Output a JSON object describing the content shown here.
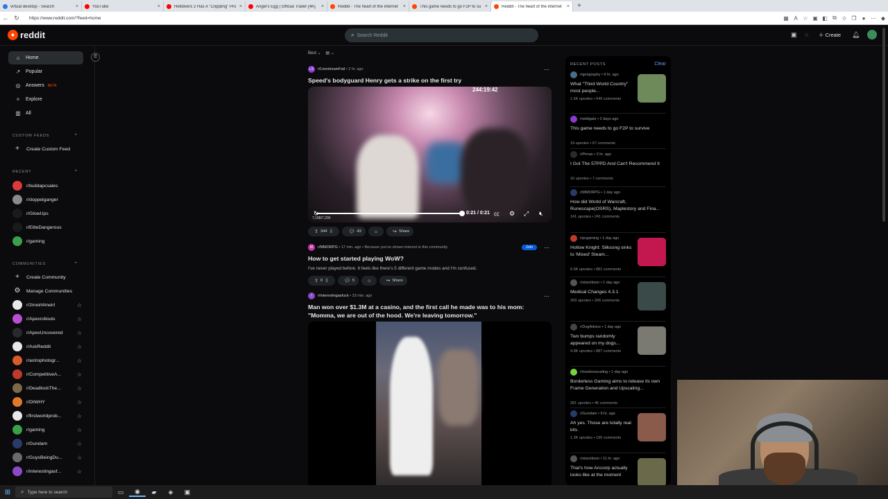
{
  "browser": {
    "tabs": [
      {
        "title": "virtual desktop - Search",
        "color": "#2a7ae2"
      },
      {
        "title": "YouTube",
        "color": "#ff0000"
      },
      {
        "title": "Helldivers 2 Has A \"Crippling\" Pro",
        "color": "#ff0000"
      },
      {
        "title": "Angel's Egg | Official Trailer [4K]",
        "color": "#ff0000"
      },
      {
        "title": "Reddit - The heart of the internet",
        "color": "#ff4500"
      },
      {
        "title": "This game needs to go F2P to su",
        "color": "#ff4500"
      },
      {
        "title": "Reddit - The heart of the internet",
        "color": "#ff4500"
      }
    ],
    "active_tab": 6,
    "url": "https://www.reddit.com/?feed=home"
  },
  "header": {
    "logo_text": "reddit",
    "search_placeholder": "Search Reddit",
    "create_label": "Create"
  },
  "leftnav": {
    "items": [
      {
        "label": "Home",
        "icon": "home-icon",
        "glyph": "⌂"
      },
      {
        "label": "Popular",
        "icon": "popular-icon",
        "glyph": "↗"
      },
      {
        "label": "Answers",
        "icon": "answers-icon",
        "glyph": "◎"
      },
      {
        "label": "Explore",
        "icon": "explore-icon",
        "glyph": "✧"
      },
      {
        "label": "All",
        "icon": "all-icon",
        "glyph": "▥"
      }
    ],
    "answers_badge": "BETA",
    "custom_feeds_header": "CUSTOM FEEDS",
    "create_custom_feed": "Create Custom Feed",
    "recent_header": "RECENT",
    "recent": [
      {
        "name": "r/buildapcsales",
        "color": "#d93a3a"
      },
      {
        "name": "r/doppelganger",
        "color": "#8a8a8a"
      },
      {
        "name": "r/GlowUps",
        "color": "#1a1a1a"
      },
      {
        "name": "r/EliteDangerous",
        "color": "#1a1a1a"
      },
      {
        "name": "r/gaming",
        "color": "#3aa14a"
      }
    ],
    "communities_header": "COMMUNITIES",
    "create_community": "Create Community",
    "manage_communities": "Manage Communities",
    "communities": [
      {
        "name": "r/2meirl4meirl",
        "color": "#e8e8e8"
      },
      {
        "name": "r/Apexrollouts",
        "color": "#b84fd1"
      },
      {
        "name": "r/ApexUncovered",
        "color": "#2a2a2a"
      },
      {
        "name": "r/AskReddit",
        "color": "#e8e8e8"
      },
      {
        "name": "r/astrophotogr...",
        "color": "#d95a2a"
      },
      {
        "name": "r/CompetitiveA...",
        "color": "#c0392b"
      },
      {
        "name": "r/DeadlockThe...",
        "color": "#7a6a4a"
      },
      {
        "name": "r/DIWHY",
        "color": "#e07a2a"
      },
      {
        "name": "r/firstworldprob...",
        "color": "#e8e8e8"
      },
      {
        "name": "r/gaming",
        "color": "#3aa14a"
      },
      {
        "name": "r/Gundam",
        "color": "#2a3a6a"
      },
      {
        "name": "r/GuysBeingDu...",
        "color": "#6a6a6a"
      },
      {
        "name": "r/interestingasf...",
        "color": "#8a4ac8"
      }
    ]
  },
  "feed": {
    "sort_label": "Best",
    "posts": [
      {
        "sub": "r/LivestreamFail",
        "time": "2 hr. ago",
        "title": "Speed's bodyguard Henry gets a strike on the first try",
        "upvotes": "344",
        "comments": "43",
        "share": "Share",
        "video_counter": "244:19:42",
        "video_time": "0:21 / 0:21",
        "video_small": "7,188/7,200"
      },
      {
        "sub": "r/MMORPG",
        "time": "17 min. ago",
        "reason": "Because you've shown interest in this community",
        "join": "Join",
        "title": "How to get started playing WoW?",
        "body": "I've never played before. It feels like there's 5 different game modes and I'm confused.",
        "upvotes": "0",
        "comments": "5",
        "share": "Share"
      },
      {
        "sub": "r/interestingasfuck",
        "time": "23 min. ago",
        "title": "Man won over $1.3M at a casino, and the first call he made was to his mom: \"Momma, we are out of the hood. We're leaving tomorrow.\""
      }
    ]
  },
  "recent_posts": {
    "header": "RECENT POSTS",
    "clear": "Clear",
    "items": [
      {
        "sub": "r/geography",
        "time": "6 hr. ago",
        "title": "What \"Third World Country\" most people...",
        "upvotes": "1.5K upvotes",
        "comments": "549 comments",
        "thumb": "#6f8a5a"
      },
      {
        "sub": "r/wildgate",
        "time": "2 days ago",
        "title": "This game needs to go F2P to survive",
        "upvotes": "19 upvotes",
        "comments": "67 comments",
        "thumb": ""
      },
      {
        "sub": "r/Pimax",
        "time": "3 hr. ago",
        "title": "I Got The 57PPD And Can't Recommend It",
        "upvotes": "16 upvotes",
        "comments": "7 comments",
        "thumb": ""
      },
      {
        "sub": "r/MMORPG",
        "time": "1 day ago",
        "title": "How did World of Warcraft, Runescape(OSRS), Maplestory and Fina...",
        "upvotes": "141 upvotes",
        "comments": "241 comments",
        "thumb": ""
      },
      {
        "sub": "r/pcgaming",
        "time": "1 day ago",
        "title": "Hollow Knight: Silksong sinks to 'Mixed' Steam...",
        "upvotes": "6.5K upvotes",
        "comments": "881 comments",
        "thumb": "#c2184f"
      },
      {
        "sub": "r/starcitizen",
        "time": "1 day ago",
        "title": "Medical Changes 4.3.1",
        "upvotes": "293 upvotes",
        "comments": "206 comments",
        "thumb": "#3a4a48"
      },
      {
        "sub": "r/DogAdvice",
        "time": "1 day ago",
        "title": "Two bumps randomly appeared on my dogs...",
        "upvotes": "4.9K upvotes",
        "comments": "887 comments",
        "thumb": "#7a7a72"
      },
      {
        "sub": "r/losslessscaling",
        "time": "1 day ago",
        "title": "Borderless Gaming aims to release its own Frame Generation and Upscaling...",
        "upvotes": "281 upvotes",
        "comments": "45 comments",
        "thumb": ""
      },
      {
        "sub": "r/Gundam",
        "time": "9 hr. ago",
        "title": "Ah yes. Those are totally real kits.",
        "upvotes": "1.3K upvotes",
        "comments": "195 comments",
        "thumb": "#8a5a4a"
      },
      {
        "sub": "r/starcitizen",
        "time": "11 hr. ago",
        "title": "That's how Arccorp actually looks like at the moment",
        "upvotes": "",
        "comments": "",
        "thumb": "#6a6a4a"
      }
    ]
  },
  "taskbar": {
    "search_placeholder": "Type here to search"
  }
}
